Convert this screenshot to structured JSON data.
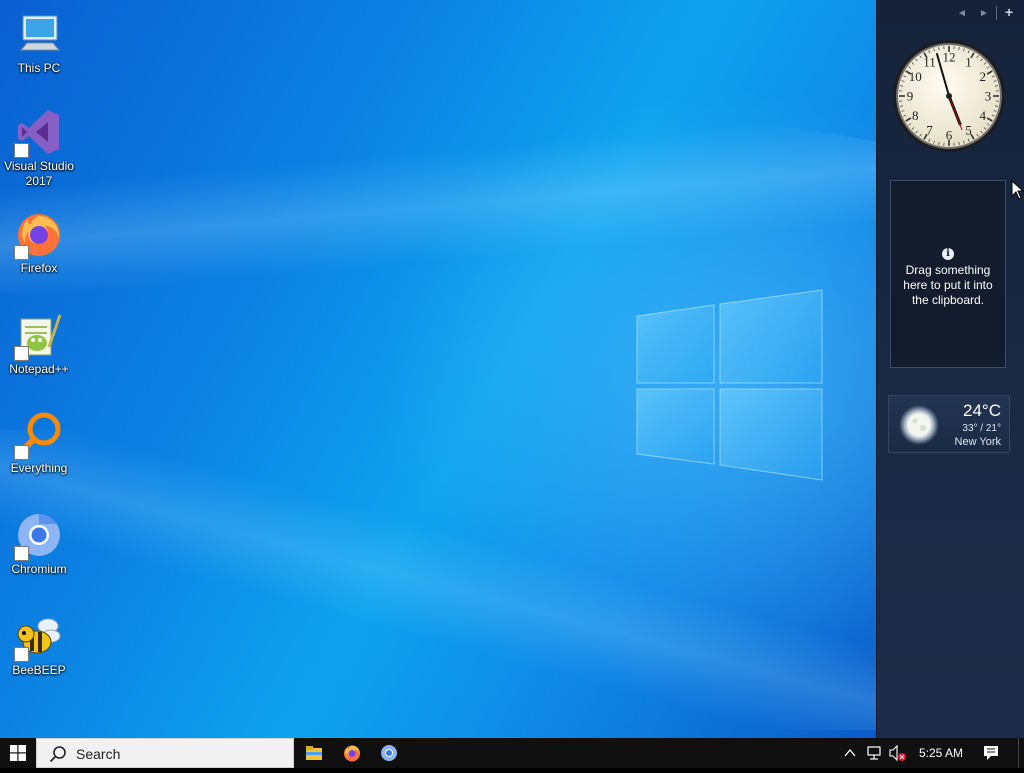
{
  "desktop": {
    "icons": [
      {
        "label": "This PC",
        "icon": "computer-icon"
      },
      {
        "label": "Visual Studio\n2017",
        "icon": "visual-studio-icon"
      },
      {
        "label": "Firefox",
        "icon": "firefox-icon"
      },
      {
        "label": "Notepad++",
        "icon": "notepad-plus-plus-icon"
      },
      {
        "label": "Everything",
        "icon": "magnifier-everything-icon"
      },
      {
        "label": "Chromium",
        "icon": "chromium-icon"
      },
      {
        "label": "BeeBEEP",
        "icon": "bee-icon"
      }
    ]
  },
  "sidebar": {
    "controls": {
      "prev": "◄",
      "next": "►",
      "add": "+"
    },
    "clock": {
      "numerals": [
        "12",
        "1",
        "2",
        "3",
        "4",
        "5",
        "6",
        "7",
        "8",
        "9",
        "10",
        "11"
      ],
      "time": "5:25"
    },
    "clipboard": {
      "info_glyph": "i",
      "text": "Drag something here to put it into the clipboard."
    },
    "weather": {
      "temperature": "24°C",
      "range": "33° / 21°",
      "city": "New York",
      "icon": "moon-icon"
    }
  },
  "taskbar": {
    "search_placeholder": "Search",
    "pinned": [
      "file-explorer-icon",
      "firefox-icon",
      "chromium-icon"
    ],
    "time": "5:25 AM"
  },
  "colors": {
    "wallpaper_accent": "#0ea3ee",
    "sidebar_bg": "#15223a",
    "taskbar_bg": "#101010"
  }
}
